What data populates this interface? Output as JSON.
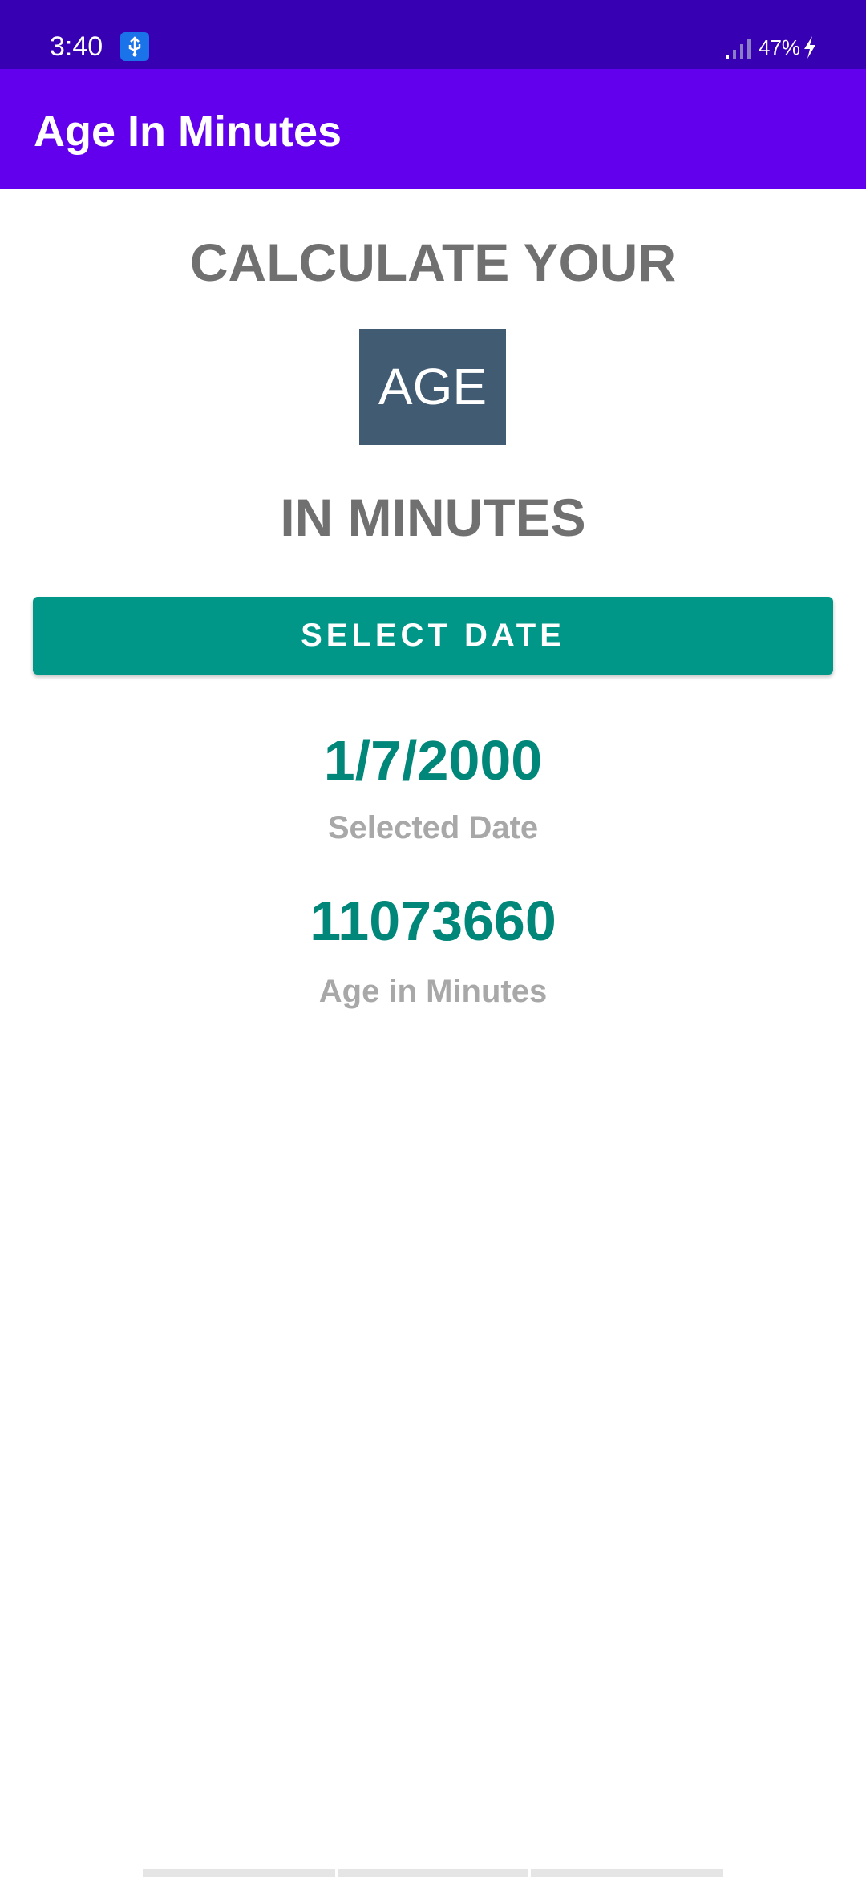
{
  "status_bar": {
    "time": "3:40",
    "battery": "47%",
    "icons": [
      "usb-icon",
      "signal-icon",
      "charging-bolt-icon"
    ],
    "color": "#3700b3"
  },
  "app_bar": {
    "title": "Age In Minutes",
    "color": "#6200ee"
  },
  "main": {
    "heading_line1": "CALCULATE YOUR",
    "age_label": "AGE",
    "heading_line2": "IN MINUTES",
    "select_button_label": "SELECT DATE",
    "selected_date_value": "1/7/2000",
    "selected_date_caption": "Selected Date",
    "age_minutes_value": "11073660",
    "age_minutes_caption": "Age in Minutes"
  },
  "colors": {
    "button": "#009688",
    "value_text": "#00877a",
    "age_box": "#415b73",
    "heading_text": "#707070",
    "caption_text": "#a8a8a8"
  }
}
